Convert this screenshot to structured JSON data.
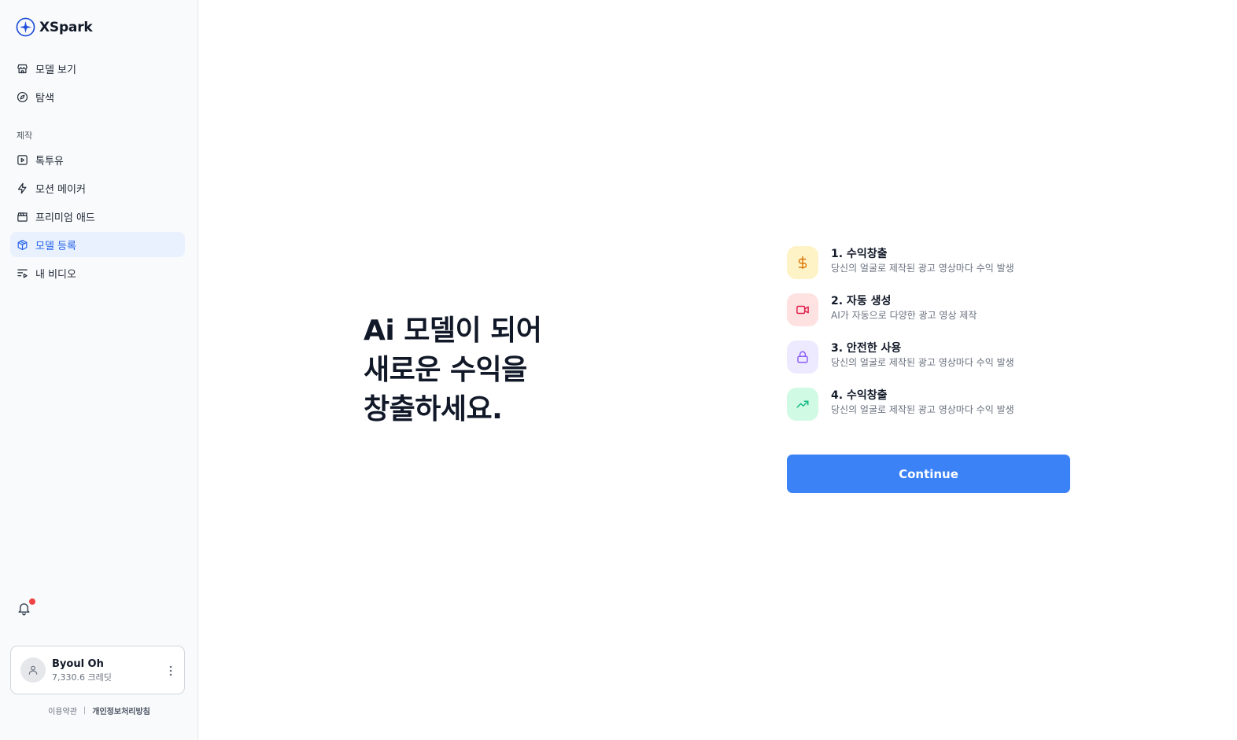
{
  "brand": {
    "name": "XSpark",
    "icon": "sparkle-logo-icon"
  },
  "sidebar": {
    "nav_top": [
      {
        "label": "모델 보기",
        "icon": "storefront-icon"
      },
      {
        "label": "탐색",
        "icon": "compass-icon"
      }
    ],
    "section_label": "제작",
    "nav_make": [
      {
        "label": "톡투유",
        "icon": "play-square-icon"
      },
      {
        "label": "모션 메이커",
        "icon": "lightning-icon"
      },
      {
        "label": "프리미엄 애드",
        "icon": "clapperboard-icon"
      },
      {
        "label": "모델 등록",
        "icon": "box-icon",
        "active": true
      },
      {
        "label": "내 비디오",
        "icon": "video-list-icon"
      }
    ],
    "notification": {
      "icon": "bell-icon",
      "has_unread": true,
      "badge_color": "#ef4444"
    },
    "user": {
      "name": "Byoul Oh",
      "credits": "7,330.6 크레딧",
      "avatar_icon": "user-icon",
      "menu_icon": "kebab-icon"
    },
    "footer": {
      "terms": "이용약관",
      "separator": "|",
      "privacy": "개인정보처리방침"
    }
  },
  "main": {
    "headline": [
      "Ai 모델이 되어",
      "새로운 수익을",
      "창출하세요."
    ],
    "features": [
      {
        "title": "1. 수익창출",
        "desc": "당신의 얼굴로 제작된 광고 영상마다 수익 발생",
        "icon": "dollar-icon",
        "bg": "#fef3c7",
        "fg": "#d97706"
      },
      {
        "title": "2. 자동 생성",
        "desc": "AI가 자동으로 다양한 광고 영상 제작",
        "icon": "video-camera-icon",
        "bg": "#fee2e2",
        "fg": "#e11d48"
      },
      {
        "title": "3. 안전한 사용",
        "desc": "당신의 얼굴로 제작된 광고 영상마다 수익 발생",
        "icon": "lock-icon",
        "bg": "#ede9fe",
        "fg": "#8b5cf6"
      },
      {
        "title": "4. 수익창출",
        "desc": "당신의 얼굴로 제작된 광고 영상마다 수익 발생",
        "icon": "trending-up-icon",
        "bg": "#d1fae5",
        "fg": "#10b981"
      }
    ],
    "continue_label": "Continue",
    "accent": "#3b82f6"
  }
}
